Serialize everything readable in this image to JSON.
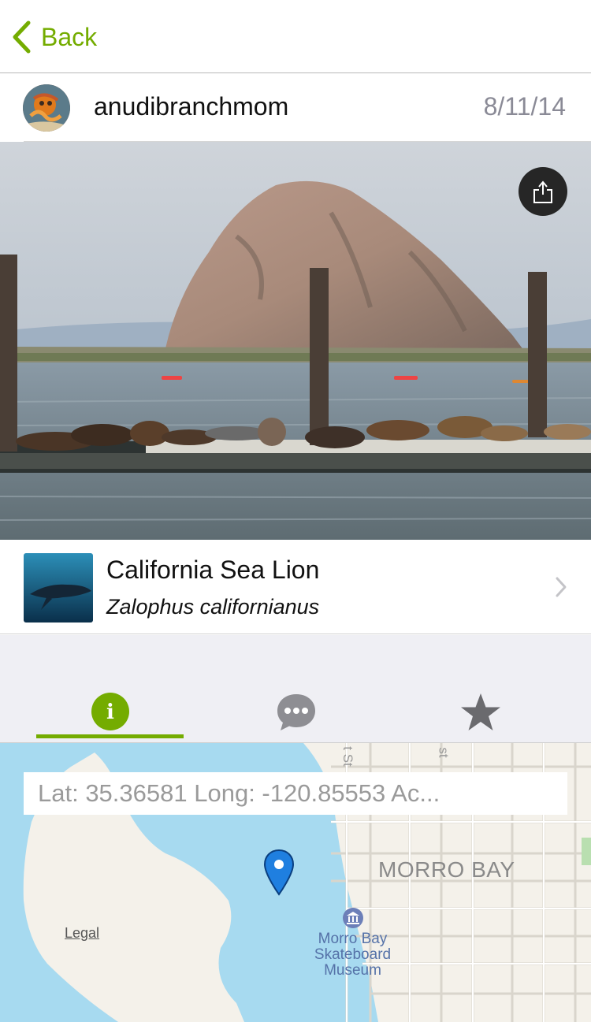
{
  "nav": {
    "back_label": "Back"
  },
  "user": {
    "username": "anudibranchmom",
    "date": "8/11/14"
  },
  "taxon": {
    "common_name": "California Sea Lion",
    "scientific_name": "Zalophus californianus"
  },
  "tabs": [
    {
      "name": "info-tab",
      "icon": "info-icon",
      "label": "i"
    },
    {
      "name": "comments-tab",
      "icon": "comment-bubble-icon"
    },
    {
      "name": "favorites-tab",
      "icon": "star-icon"
    }
  ],
  "map": {
    "coordinates": "Lat: 35.36581 Long: -120.85553 Ac...",
    "legal": "Legal",
    "city_label": "MORRO BAY",
    "poi_line1": "Morro Bay",
    "poi_line2": "Skateboard",
    "poi_line3": "Museum"
  },
  "colors": {
    "accent": "#74ac00",
    "water": "#a7daf0",
    "land": "#f4f1ea",
    "pin": "#1f7fe0"
  }
}
